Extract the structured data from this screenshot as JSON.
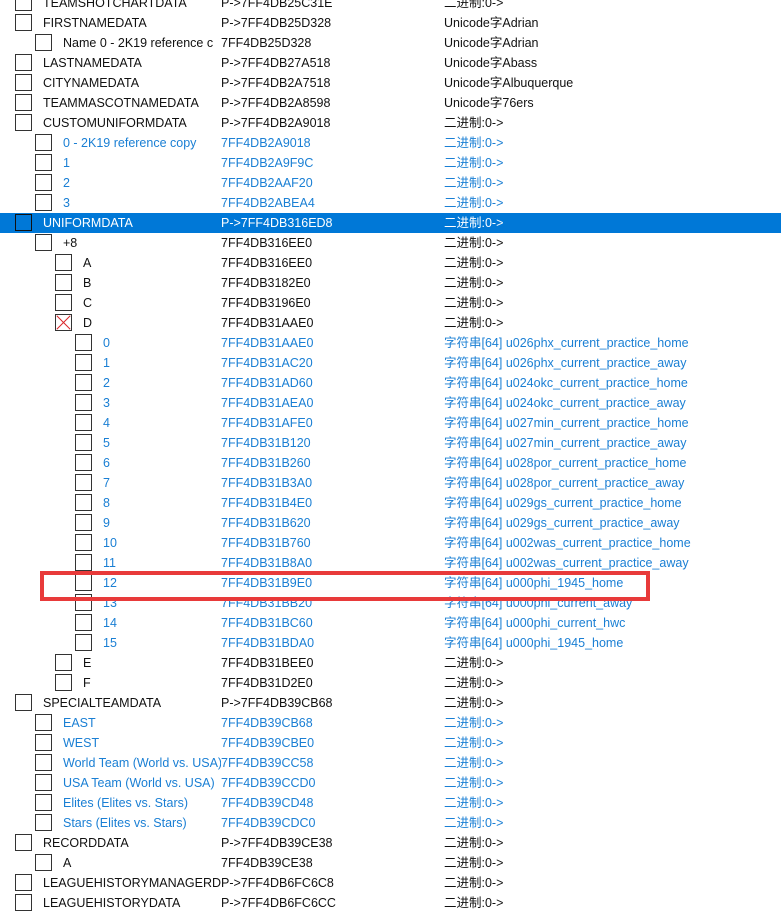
{
  "colors": {
    "selected_bg": "#0078d7",
    "link_blue": "#1a7fd4",
    "highlight": "#e83a3a"
  },
  "rows": [
    {
      "level": 0,
      "name": "TEAMSHOTCHARTDATA",
      "addr": "P->7FF4DB25C31E",
      "value": "二进制:0->",
      "style": "normal"
    },
    {
      "level": 0,
      "name": "FIRSTNAMEDATA",
      "addr": "P->7FF4DB25D328",
      "value": "Unicode字Adrian",
      "style": "normal"
    },
    {
      "level": 1,
      "name": "Name 0 - 2K19 reference c",
      "addr": "7FF4DB25D328",
      "value": "Unicode字Adrian",
      "style": "normal"
    },
    {
      "level": 0,
      "name": "LASTNAMEDATA",
      "addr": "P->7FF4DB27A518",
      "value": "Unicode字Abass",
      "style": "normal"
    },
    {
      "level": 0,
      "name": "CITYNAMEDATA",
      "addr": "P->7FF4DB2A7518",
      "value": "Unicode字Albuquerque",
      "style": "normal"
    },
    {
      "level": 0,
      "name": "TEAMMASCOTNAMEDATA",
      "addr": "P->7FF4DB2A8598",
      "value": "Unicode字76ers",
      "style": "normal"
    },
    {
      "level": 0,
      "name": "CUSTOMUNIFORMDATA",
      "addr": "P->7FF4DB2A9018",
      "value": "二进制:0->",
      "style": "normal"
    },
    {
      "level": 1,
      "name": "0 - 2K19 reference copy",
      "addr": "7FF4DB2A9018",
      "value": "二进制:0->",
      "style": "blue"
    },
    {
      "level": 1,
      "name": "1",
      "addr": "7FF4DB2A9F9C",
      "value": "二进制:0->",
      "style": "blue"
    },
    {
      "level": 1,
      "name": "2",
      "addr": "7FF4DB2AAF20",
      "value": "二进制:0->",
      "style": "blue"
    },
    {
      "level": 1,
      "name": "3",
      "addr": "7FF4DB2ABEA4",
      "value": "二进制:0->",
      "style": "blue"
    },
    {
      "level": 0,
      "name": "UNIFORMDATA",
      "addr": "P->7FF4DB316ED8",
      "value": "二进制:0->",
      "style": "selected"
    },
    {
      "level": 1,
      "name": "+8",
      "addr": "7FF4DB316EE0",
      "value": "二进制:0->",
      "style": "normal"
    },
    {
      "level": 2,
      "name": "A",
      "addr": "7FF4DB316EE0",
      "value": "二进制:0->",
      "style": "normal"
    },
    {
      "level": 2,
      "name": "B",
      "addr": "7FF4DB3182E0",
      "value": "二进制:0->",
      "style": "normal"
    },
    {
      "level": 2,
      "name": "C",
      "addr": "7FF4DB3196E0",
      "value": "二进制:0->",
      "style": "normal"
    },
    {
      "level": 2,
      "name": "D",
      "addr": "7FF4DB31AAE0",
      "value": "二进制:0->",
      "style": "normal",
      "crossed": true
    },
    {
      "level": 3,
      "name": "0",
      "addr": "7FF4DB31AAE0",
      "value": "字符串[64] u026phx_current_practice_home",
      "style": "blue"
    },
    {
      "level": 3,
      "name": "1",
      "addr": "7FF4DB31AC20",
      "value": "字符串[64] u026phx_current_practice_away",
      "style": "blue"
    },
    {
      "level": 3,
      "name": "2",
      "addr": "7FF4DB31AD60",
      "value": "字符串[64] u024okc_current_practice_home",
      "style": "blue"
    },
    {
      "level": 3,
      "name": "3",
      "addr": "7FF4DB31AEA0",
      "value": "字符串[64] u024okc_current_practice_away",
      "style": "blue"
    },
    {
      "level": 3,
      "name": "4",
      "addr": "7FF4DB31AFE0",
      "value": "字符串[64] u027min_current_practice_home",
      "style": "blue"
    },
    {
      "level": 3,
      "name": "5",
      "addr": "7FF4DB31B120",
      "value": "字符串[64] u027min_current_practice_away",
      "style": "blue"
    },
    {
      "level": 3,
      "name": "6",
      "addr": "7FF4DB31B260",
      "value": "字符串[64] u028por_current_practice_home",
      "style": "blue"
    },
    {
      "level": 3,
      "name": "7",
      "addr": "7FF4DB31B3A0",
      "value": "字符串[64] u028por_current_practice_away",
      "style": "blue"
    },
    {
      "level": 3,
      "name": "8",
      "addr": "7FF4DB31B4E0",
      "value": "字符串[64] u029gs_current_practice_home",
      "style": "blue"
    },
    {
      "level": 3,
      "name": "9",
      "addr": "7FF4DB31B620",
      "value": "字符串[64] u029gs_current_practice_away",
      "style": "blue"
    },
    {
      "level": 3,
      "name": "10",
      "addr": "7FF4DB31B760",
      "value": "字符串[64] u002was_current_practice_home",
      "style": "blue"
    },
    {
      "level": 3,
      "name": "11",
      "addr": "7FF4DB31B8A0",
      "value": "字符串[64] u002was_current_practice_away",
      "style": "blue"
    },
    {
      "level": 3,
      "name": "12",
      "addr": "7FF4DB31B9E0",
      "value": "字符串[64] u000phi_1945_home",
      "style": "blue",
      "highlighted": true
    },
    {
      "level": 3,
      "name": "13",
      "addr": "7FF4DB31BB20",
      "value": "字符串[64] u000phi_current_away",
      "style": "blue"
    },
    {
      "level": 3,
      "name": "14",
      "addr": "7FF4DB31BC60",
      "value": "字符串[64] u000phi_current_hwc",
      "style": "blue"
    },
    {
      "level": 3,
      "name": "15",
      "addr": "7FF4DB31BDA0",
      "value": "字符串[64] u000phi_1945_home",
      "style": "blue"
    },
    {
      "level": 2,
      "name": "E",
      "addr": "7FF4DB31BEE0",
      "value": "二进制:0->",
      "style": "normal"
    },
    {
      "level": 2,
      "name": "F",
      "addr": "7FF4DB31D2E0",
      "value": "二进制:0->",
      "style": "normal"
    },
    {
      "level": 0,
      "name": "SPECIALTEAMDATA",
      "addr": "P->7FF4DB39CB68",
      "value": "二进制:0->",
      "style": "normal"
    },
    {
      "level": 1,
      "name": "EAST",
      "addr": "7FF4DB39CB68",
      "value": "二进制:0->",
      "style": "blue"
    },
    {
      "level": 1,
      "name": "WEST",
      "addr": "7FF4DB39CBE0",
      "value": "二进制:0->",
      "style": "blue"
    },
    {
      "level": 1,
      "name": "World Team (World vs. USA)",
      "addr": "7FF4DB39CC58",
      "value": "二进制:0->",
      "style": "blue"
    },
    {
      "level": 1,
      "name": "USA Team (World vs. USA)",
      "addr": "7FF4DB39CCD0",
      "value": "二进制:0->",
      "style": "blue"
    },
    {
      "level": 1,
      "name": "Elites (Elites vs. Stars)",
      "addr": "7FF4DB39CD48",
      "value": "二进制:0->",
      "style": "blue"
    },
    {
      "level": 1,
      "name": "Stars (Elites vs. Stars)",
      "addr": "7FF4DB39CDC0",
      "value": "二进制:0->",
      "style": "blue"
    },
    {
      "level": 0,
      "name": "RECORDDATA",
      "addr": "P->7FF4DB39CE38",
      "value": "二进制:0->",
      "style": "normal"
    },
    {
      "level": 1,
      "name": "A",
      "addr": "7FF4DB39CE38",
      "value": "二进制:0->",
      "style": "normal"
    },
    {
      "level": 0,
      "name": "LEAGUEHISTORYMANAGERDATA",
      "addr": "P->7FF4DB6FC6C8",
      "value": "二进制:0->",
      "style": "normal"
    },
    {
      "level": 0,
      "name": "LEAGUEHISTORYDATA",
      "addr": "P->7FF4DB6FC6CC",
      "value": "二进制:0->",
      "style": "normal"
    }
  ]
}
